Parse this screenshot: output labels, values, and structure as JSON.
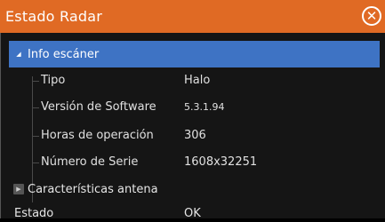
{
  "dialog": {
    "title": "Estado Radar",
    "close_label": "✕"
  },
  "tree": {
    "section_scanner": {
      "label": "Info escáner",
      "expanded": true,
      "items": [
        {
          "label": "Tipo",
          "value": "Halo"
        },
        {
          "label": "Versión de Software",
          "value": "5.3.1.94"
        },
        {
          "label": "Horas de operación",
          "value": "306"
        },
        {
          "label": "Número de Serie",
          "value": "1608x32251"
        }
      ]
    },
    "section_antenna": {
      "label": "Características antena",
      "expanded": false
    },
    "section_partial": {
      "label": "Estado",
      "value": "OK"
    }
  },
  "colors": {
    "titlebar": "#e06a24",
    "selected_row": "#3e73c4",
    "background": "#151515"
  }
}
